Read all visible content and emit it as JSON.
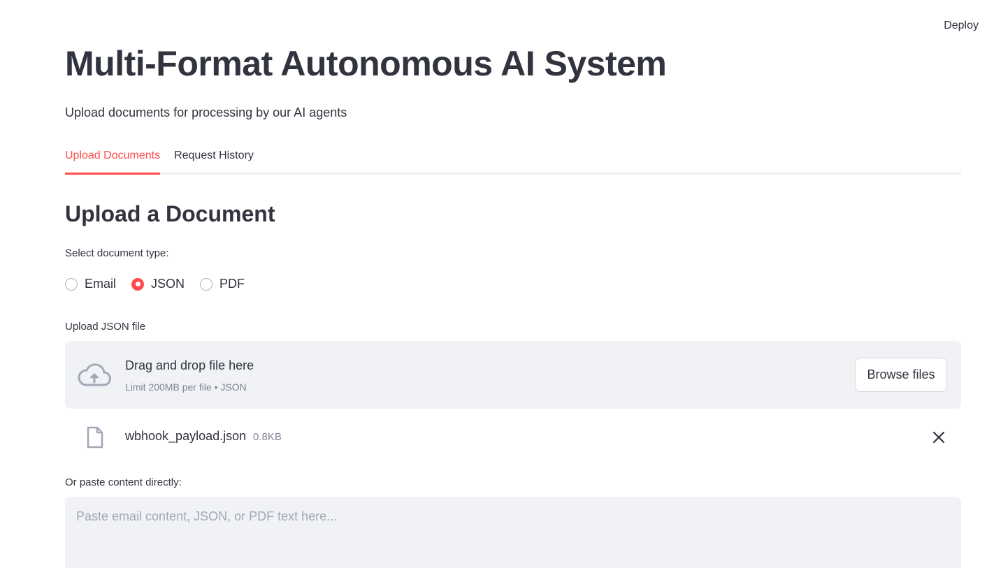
{
  "header": {
    "deploy_label": "Deploy"
  },
  "page": {
    "title": "Multi-Format Autonomous AI System",
    "subtitle": "Upload documents for processing by our AI agents"
  },
  "tabs": [
    {
      "label": "Upload Documents",
      "active": true
    },
    {
      "label": "Request History",
      "active": false
    }
  ],
  "upload": {
    "section_title": "Upload a Document",
    "doc_type_label": "Select document type:",
    "options": [
      {
        "label": "Email",
        "selected": false
      },
      {
        "label": "JSON",
        "selected": true
      },
      {
        "label": "PDF",
        "selected": false
      }
    ],
    "file_label": "Upload JSON file",
    "dropzone": {
      "title": "Drag and drop file here",
      "limit": "Limit 200MB per file • JSON",
      "browse_label": "Browse files"
    },
    "file": {
      "name": "wbhook_payload.json",
      "size": "0.8KB"
    },
    "paste_label": "Or paste content directly:",
    "paste_placeholder": "Paste email content, JSON, or PDF text here..."
  },
  "colors": {
    "accent": "#ff4b4b",
    "text": "#31333f",
    "muted": "#808495",
    "panel": "#f0f2f6"
  },
  "icons": {
    "upload": "cloud-upload-icon",
    "file": "file-icon",
    "close": "close-icon"
  }
}
